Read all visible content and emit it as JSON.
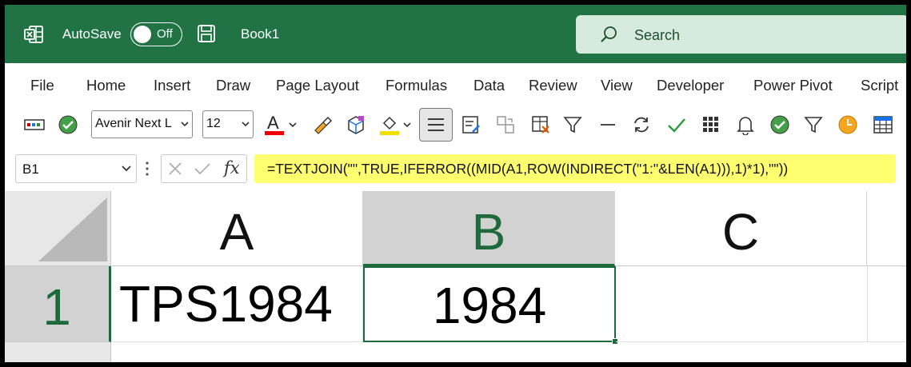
{
  "titlebar": {
    "autosave_label": "AutoSave",
    "autosave_state": "Off",
    "book_title": "Book1",
    "search_placeholder": "Search",
    "accent": "#217346"
  },
  "menu": {
    "items": [
      "File",
      "Home",
      "Insert",
      "Draw",
      "Page Layout",
      "Formulas",
      "Data",
      "Review",
      "View",
      "Developer",
      "Power Pivot",
      "Script"
    ]
  },
  "toolbar": {
    "font_name": "Avenir Next L",
    "font_size": "12",
    "font_color_letter": "A",
    "icons": [
      "camera-icon",
      "check-circle-icon",
      "font-color-icon",
      "format-painter-icon",
      "3d-box-icon",
      "fill-color-icon",
      "align-center-icon",
      "form-icon",
      "shape-swap-icon",
      "clear-format-icon",
      "filter-icon",
      "line-icon",
      "refresh-icon",
      "checkmark-icon",
      "grid-icon",
      "bell-icon",
      "check-circle-icon",
      "filter-icon",
      "clock-icon",
      "table-icon"
    ]
  },
  "formula_bar": {
    "name_box": "B1",
    "fx_label": "fx",
    "formula": "=TEXTJOIN(\"\",TRUE,IFERROR((MID(A1,ROW(INDIRECT(\"1:\"&LEN(A1))),1)*1),\"\"))",
    "highlight": "#ffff70"
  },
  "sheet": {
    "columns": [
      "A",
      "B",
      "C"
    ],
    "rows": [
      "1"
    ],
    "cells": {
      "A1": "TPS1984",
      "B1": "1984"
    },
    "selected_cell": "B1"
  }
}
